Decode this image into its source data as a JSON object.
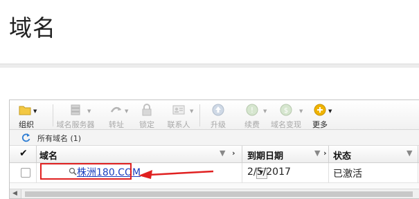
{
  "page": {
    "title": "域名"
  },
  "toolbar": {
    "buttons": [
      {
        "label": "组织",
        "icon": "folder-icon",
        "enabled": true
      },
      {
        "label": "域名服务器",
        "icon": "server-icon",
        "enabled": false
      },
      {
        "label": "转址",
        "icon": "redirect-icon",
        "enabled": false
      },
      {
        "label": "锁定",
        "icon": "lock-icon",
        "enabled": false
      },
      {
        "label": "联系人",
        "icon": "contact-card-icon",
        "enabled": false
      },
      {
        "label": "升级",
        "icon": "upgrade-icon",
        "enabled": false
      },
      {
        "label": "续费",
        "icon": "renew-icon",
        "enabled": false
      },
      {
        "label": "域名变现",
        "icon": "monetize-icon",
        "enabled": false
      },
      {
        "label": "更多",
        "icon": "more-icon",
        "enabled": true
      }
    ]
  },
  "list": {
    "scope_label": "所有域名 (1)",
    "columns": {
      "domain": "域名",
      "expires": "到期日期",
      "status": "状态"
    },
    "rows": [
      {
        "domain": "株洲180.COM",
        "expires": "2/5/2017",
        "status": "已激活"
      }
    ]
  },
  "colors": {
    "accent_red": "#e02020",
    "link_blue": "#1a3fbf",
    "coin_yellow": "#f0b400",
    "disabled_gray": "#b8b8b8"
  }
}
